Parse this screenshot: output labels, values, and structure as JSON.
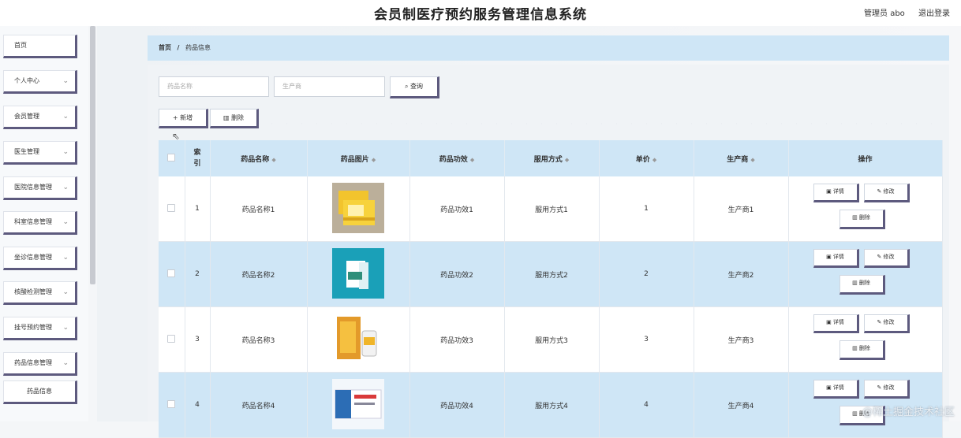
{
  "header": {
    "title": "会员制医疗预约服务管理信息系统",
    "user": "管理员 abo",
    "logout": "退出登录"
  },
  "sidebar": {
    "items": [
      {
        "label": "首页",
        "chevron": false
      },
      {
        "label": "个人中心",
        "chevron": true
      },
      {
        "label": "会员管理",
        "chevron": true
      },
      {
        "label": "医生管理",
        "chevron": true
      },
      {
        "label": "医院信息管理",
        "chevron": true
      },
      {
        "label": "科室信息管理",
        "chevron": true
      },
      {
        "label": "坐诊信息管理",
        "chevron": true
      },
      {
        "label": "核酸检测管理",
        "chevron": true
      },
      {
        "label": "挂号预约管理",
        "chevron": true
      },
      {
        "label": "药品信息管理",
        "chevron": true
      },
      {
        "label": "药品信息",
        "chevron": false,
        "sub": true
      }
    ]
  },
  "breadcrumb": {
    "home": "首页",
    "sep": "/",
    "current": "药品信息"
  },
  "search": {
    "name_placeholder": "药品名称",
    "maker_placeholder": "生产商",
    "query_label": "查询"
  },
  "toolbar": {
    "add_label": "新增",
    "delete_label": "删除"
  },
  "table": {
    "columns": [
      "索引",
      "药品名称",
      "药品图片",
      "药品功效",
      "服用方式",
      "单价",
      "生产商",
      "操作"
    ],
    "rows": [
      {
        "index": "1",
        "name": "药品名称1",
        "effect": "药品功效1",
        "usage": "服用方式1",
        "price": "1",
        "maker": "生产商1"
      },
      {
        "index": "2",
        "name": "药品名称2",
        "effect": "药品功效2",
        "usage": "服用方式2",
        "price": "2",
        "maker": "生产商2"
      },
      {
        "index": "3",
        "name": "药品名称3",
        "effect": "药品功效3",
        "usage": "服用方式3",
        "price": "3",
        "maker": "生产商3"
      },
      {
        "index": "4",
        "name": "药品名称4",
        "effect": "药品功效4",
        "usage": "服用方式4",
        "price": "4",
        "maker": "生产商4"
      }
    ],
    "actions": {
      "detail": "详情",
      "edit": "修改",
      "delete": "删除"
    }
  },
  "watermark": "@稀土掘金技术社区",
  "icons": {
    "sort": "sort-icon",
    "search": "search-icon",
    "plus": "plus-icon",
    "trash": "trash-icon",
    "detail": "detail-icon",
    "edit": "edit-icon",
    "chevron": "chevron-down-icon"
  },
  "colors": {
    "accent": "#cfe6f6",
    "button_border": "#5d5a7e"
  }
}
